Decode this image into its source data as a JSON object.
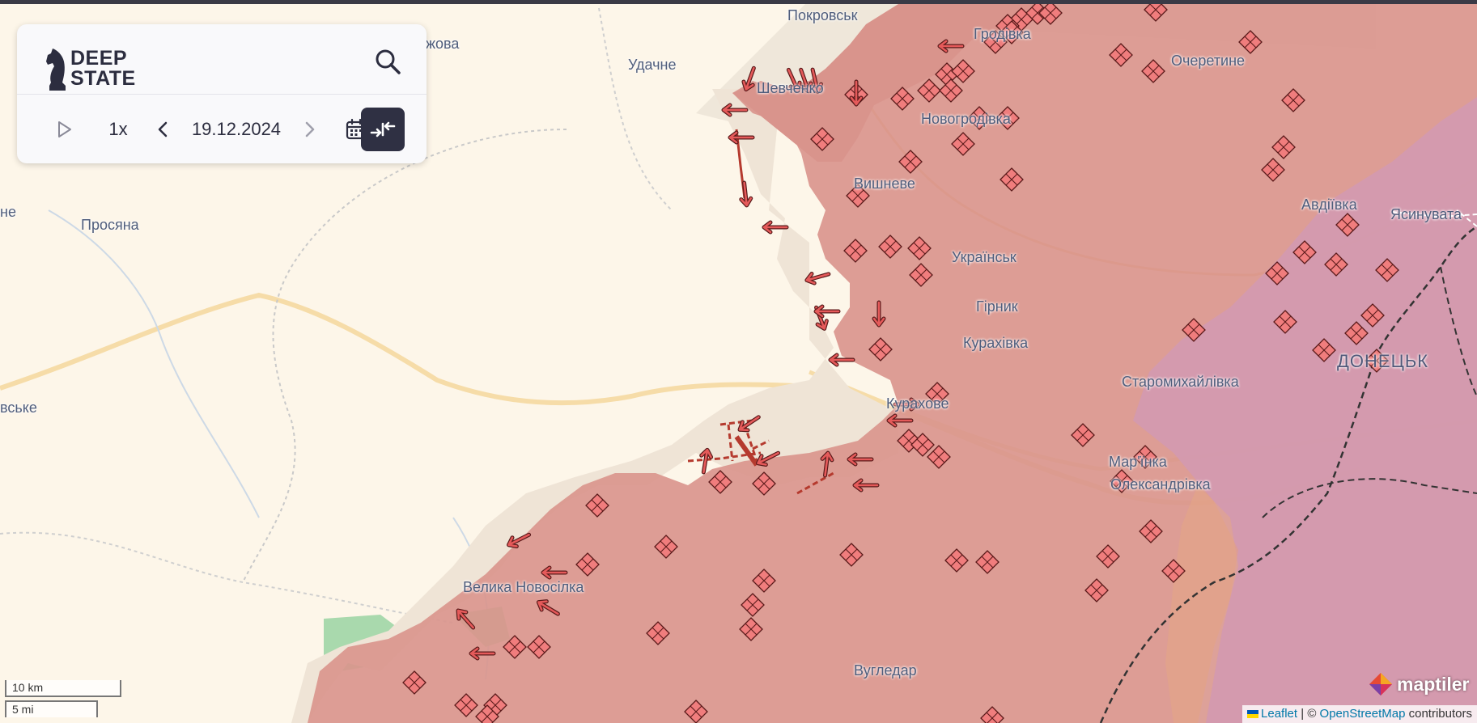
{
  "brand": {
    "line1": "DEEP",
    "line2": "STATE"
  },
  "toolbar": {
    "speed": "1x",
    "date": "19.12.2024",
    "icons": [
      "play-icon",
      "chevron-left-icon",
      "chevron-right-icon",
      "calendar-icon",
      "compare-arrows-icon",
      "search-icon",
      "knight-logo-icon"
    ]
  },
  "map": {
    "places": [
      "Покровськ",
      "Гродівка",
      "Удачне",
      "Шевченко",
      "Новогродівка",
      "Очеретине",
      "Вишневе",
      "Авдіївка",
      "Ясинувата",
      "Просяна",
      "Українськ",
      "Гірник",
      "Курахівка",
      "ДОНЕЦЬК",
      "Курахове",
      "Старомихайлівка",
      "Мар'їнка",
      "Олександрівка",
      "Велика Новосілка",
      "Вугледар",
      "жова",
      "не",
      "вське"
    ],
    "colors": {
      "occupied": "#d9948c",
      "contested": "#efe7da",
      "donetsk_region": "#d39ab0",
      "cauldron_marker": "#f07d7d",
      "attack_arrow": "#e55a5a",
      "background": "#fdf6e9",
      "road": "#f5d9a2"
    }
  },
  "scale": {
    "metric": "10 km",
    "imperial": "5 mi"
  },
  "attribution": {
    "leaflet": "Leaflet",
    "separator": "| ©",
    "osm": "OpenStreetMap",
    "suffix": "contributors",
    "maptiler": "maptiler"
  }
}
